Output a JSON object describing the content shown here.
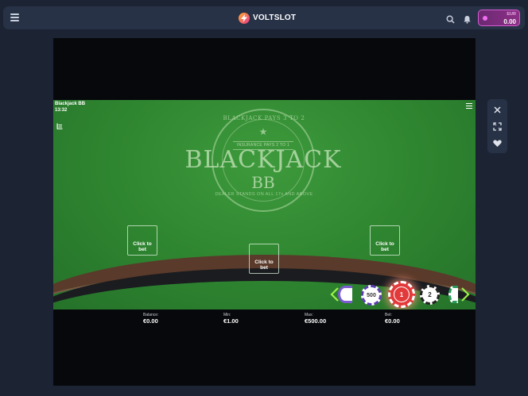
{
  "header": {
    "brand": "VOLTSLOT",
    "wallet": {
      "currency": "EUR",
      "amount": "0.00"
    }
  },
  "game": {
    "name": "Blackjack BB",
    "time": "13:32",
    "logo": {
      "pays": "BLACKJACK PAYS 3 TO 2",
      "insurance": "INSURANCE PAYS 2 TO 1",
      "title": "BLACKJACK",
      "subtitle": "BB",
      "dealer_rule": "DEALER STANDS ON ALL 17s AND ABOVE"
    },
    "bet_spots": [
      {
        "label_line1": "Click to",
        "label_line2": "bet"
      },
      {
        "label_line1": "Click to",
        "label_line2": "bet"
      },
      {
        "label_line1": "Click to",
        "label_line2": "bet"
      }
    ],
    "chips": [
      {
        "value": "500",
        "color": "#ffffff",
        "accent": "#5b3fb0"
      },
      {
        "value": "1",
        "color": "#e23a3a",
        "accent": "#ffffff",
        "selected": true
      },
      {
        "value": "2",
        "color": "#ffffff",
        "accent": "#222222"
      }
    ],
    "info": {
      "balance": {
        "label": "Balance:",
        "value": "€0.00"
      },
      "min": {
        "label": "Min:",
        "value": "€1.00"
      },
      "max": {
        "label": "Max:",
        "value": "€500.00"
      },
      "bet": {
        "label": "Bet:",
        "value": "€0.00"
      }
    }
  },
  "colors": {
    "felt": "#2f8630",
    "accent": "#d65bd1",
    "topbar": "#273246",
    "background": "#1c2434"
  }
}
